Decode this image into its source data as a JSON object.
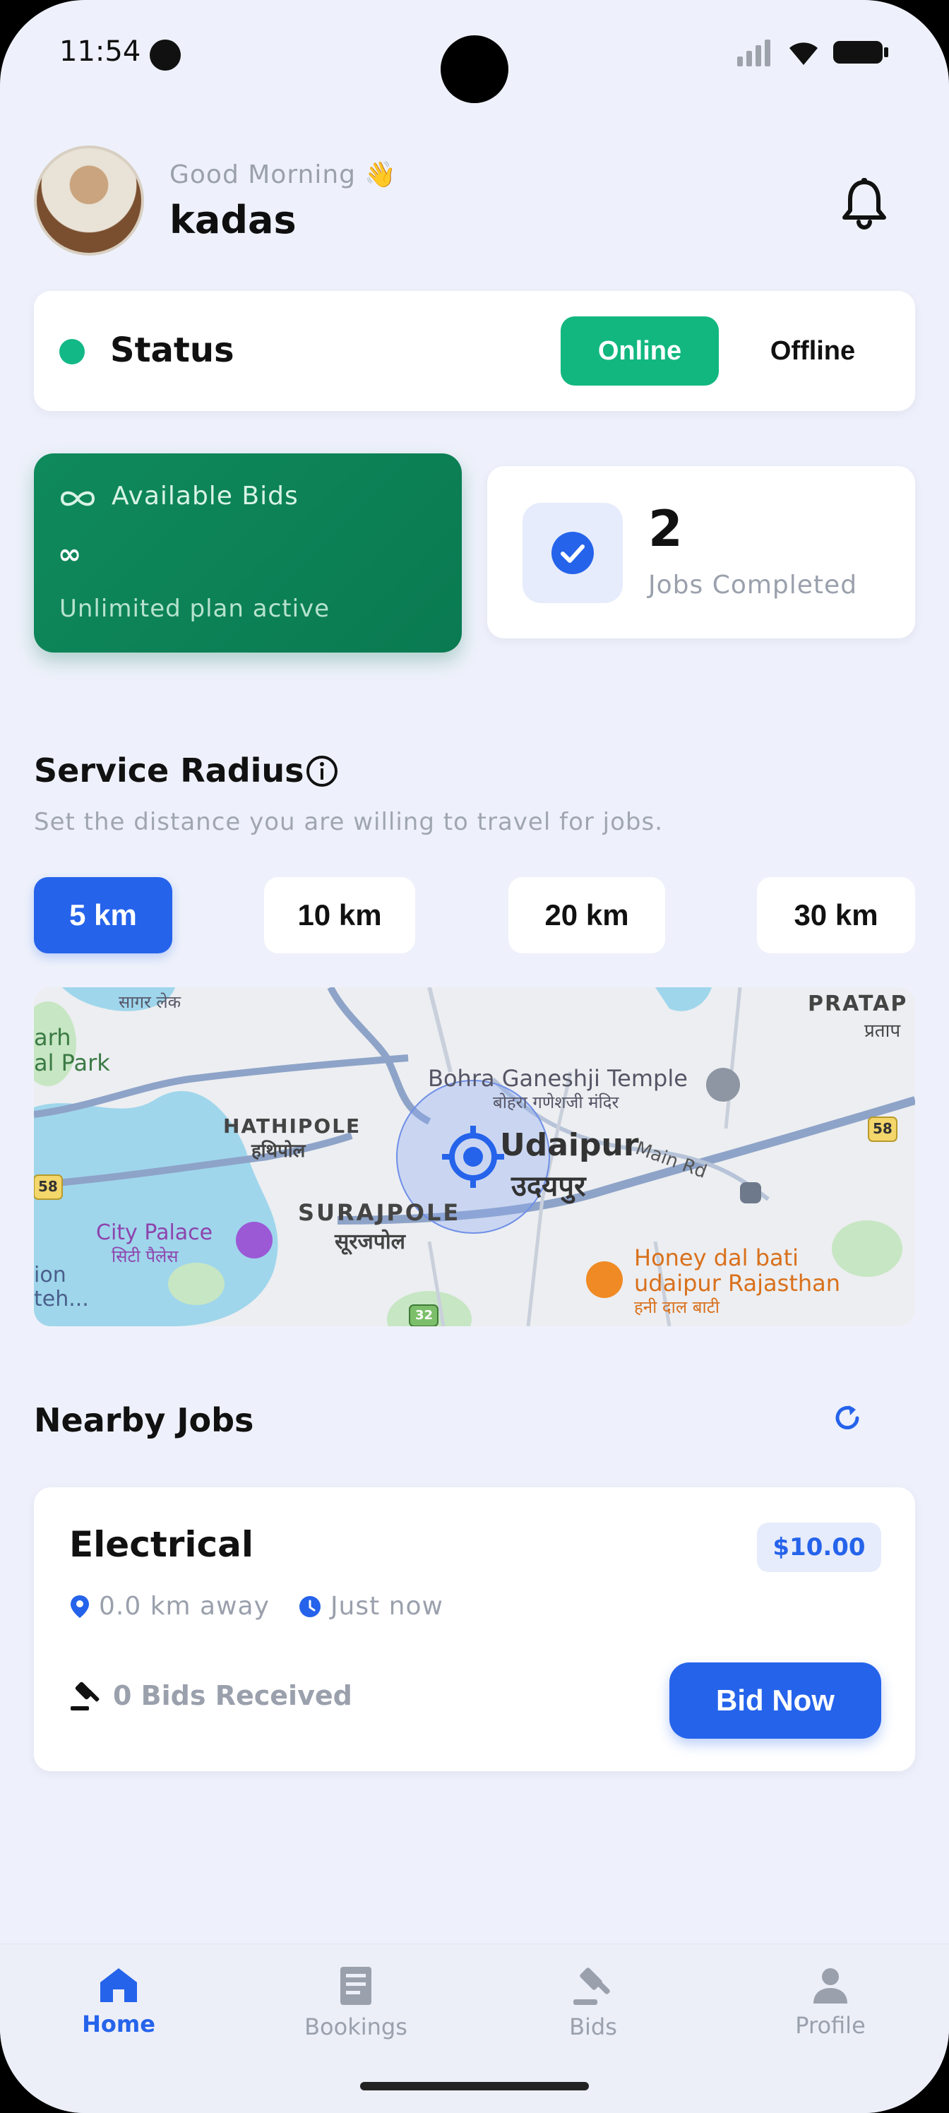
{
  "status_bar": {
    "time": "11:54"
  },
  "header": {
    "greeting": "Good Morning 👋",
    "username": "kadas"
  },
  "status": {
    "label": "Status",
    "online_label": "Online",
    "offline_label": "Offline",
    "current": "Online"
  },
  "stats": {
    "bids": {
      "title": "Available Bids",
      "value": "∞",
      "subtitle": "Unlimited plan active"
    },
    "jobs": {
      "value": "2",
      "label": "Jobs Completed"
    }
  },
  "service_radius": {
    "title": "Service Radius",
    "description": "Set the distance you are willing to travel for jobs.",
    "options": [
      "5 km",
      "10 km",
      "20 km",
      "30 km"
    ],
    "selected": "5 km"
  },
  "map": {
    "labels": {
      "sagar": "सागर लेक",
      "park1": "arh",
      "park2": "al Park",
      "pratap1": "PRATAP",
      "pratap2": "प्रताप",
      "temple1": "Bohra Ganeshji Temple",
      "temple2": "बोहरा गणेशजी मंदिर",
      "hathipole1": "HATHIPOLE",
      "hathipole2": "हथिपोल",
      "udaipur1": "Udaipur",
      "udaipur2": "उदयपुर",
      "mainrd": "Main Rd",
      "surajpole1": "SURAJPOLE",
      "surajpole2": "सूरजपोल",
      "citypalace1": "City Palace",
      "citypalace2": "सिटी पैलेस",
      "ion": "ion",
      "teh": "teh...",
      "honey1": "Honey dal bati",
      "honey2": "udaipur Rajasthan",
      "honey3": "हनी दाल बाटी",
      "hw58a": "58",
      "hw58b": "58",
      "hw32": "32"
    }
  },
  "nearby_jobs": {
    "title": "Nearby Jobs",
    "jobs": [
      {
        "title": "Electrical",
        "price": "$10.00",
        "distance": "0.0 km away",
        "time": "Just now",
        "bids": "0 Bids Received",
        "action": "Bid Now"
      }
    ]
  },
  "bottom_nav": {
    "items": [
      {
        "label": "Home",
        "icon": "home-icon",
        "active": true
      },
      {
        "label": "Bookings",
        "icon": "receipt-icon",
        "active": false
      },
      {
        "label": "Bids",
        "icon": "gavel-icon",
        "active": false
      },
      {
        "label": "Profile",
        "icon": "person-icon",
        "active": false
      }
    ]
  },
  "colors": {
    "accent": "#2563eb",
    "online": "#12b77f",
    "bids_card": "#0f8a5c",
    "background": "#EEF1FB"
  }
}
